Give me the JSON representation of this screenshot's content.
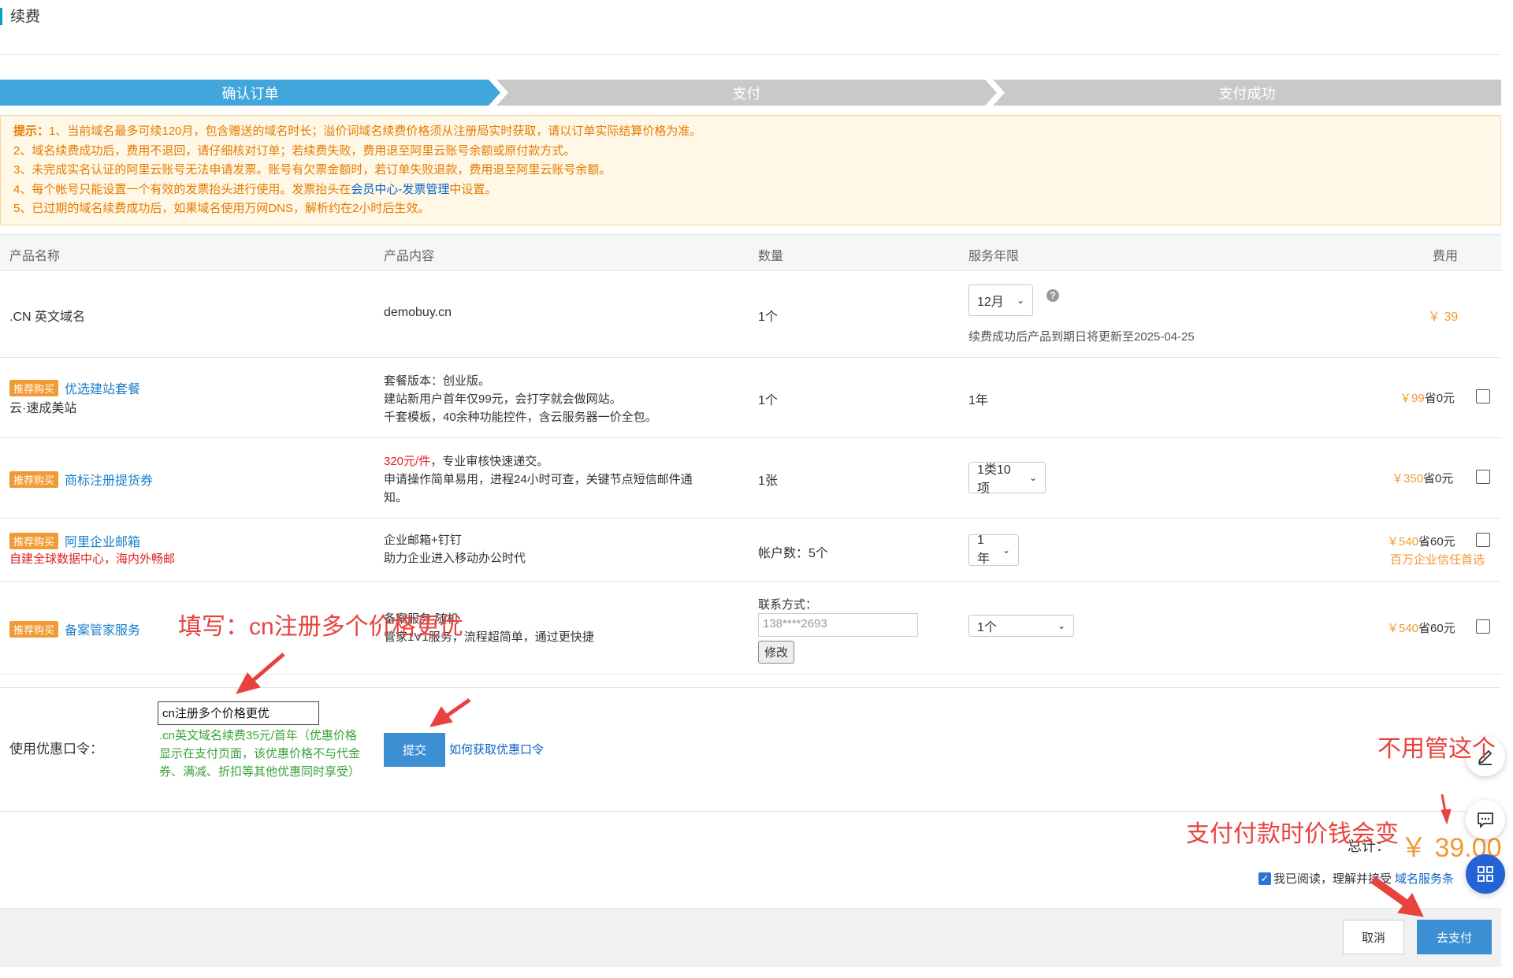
{
  "page": {
    "title": "续费"
  },
  "steps": [
    "确认订单",
    "支付",
    "支付成功"
  ],
  "notice": {
    "lines": [
      {
        "lead": "提示：",
        "text": "1、当前域名最多可续120月，包含赠送的域名时长；溢价词域名续费价格须从注册局实时获取，请以订单实际结算价格为准。"
      },
      {
        "text": "2、域名续费成功后，费用不退回，请仔细核对订单；若续费失败，费用退至阿里云账号余额或原付款方式。"
      },
      {
        "text": "3、未完成实名认证的阿里云账号无法申请发票。账号有欠票金额时，若订单失败退款，费用退至阿里云账号余额。"
      },
      {
        "text_pre": "4、每个帐号只能设置一个有效的发票抬头进行使用。发票抬头在",
        "link": "会员中心-发票管理",
        "text_post": "中设置。"
      },
      {
        "text": "5、已过期的域名续费成功后，如果域名使用万网DNS，解析约在2小时后生效。"
      }
    ]
  },
  "table": {
    "headers": [
      "产品名称",
      "产品内容",
      "数量",
      "服务年限",
      "费用"
    ],
    "rows": [
      {
        "name": ".CN 英文域名",
        "content": "demobuy.cn",
        "qty": "1个",
        "period": "12月",
        "period_note": "续费成功后产品到期日将更新至2025-04-25",
        "fee": "￥ 39"
      },
      {
        "badge": "推荐购买",
        "name": "优选建站套餐",
        "sub": "云·速成美站",
        "content": [
          "套餐版本：创业版。",
          "建站新用户首年仅99元，会打字就会做网站。",
          "千套模板，40余种功能控件，含云服务器一价全包。"
        ],
        "qty": "1个",
        "period": "1年",
        "fee_price": "￥99",
        "fee_save": "省0元"
      },
      {
        "badge": "推荐购买",
        "name": "商标注册提货券",
        "content_red": "320元/件",
        "content_rest": "，专业审核快速递交。",
        "content2": "申请操作简单易用，进程24小时可查，关键节点短信邮件通",
        "content3": "知。",
        "qty": "1张",
        "period": "1类10项",
        "fee_price": "￥350",
        "fee_save": "省0元"
      },
      {
        "badge": "推荐购买",
        "name": "阿里企业邮箱",
        "sub": "自建全球数据中心，海内外畅邮",
        "content": [
          "企业邮箱+钉钉",
          "助力企业进入移动办公时代"
        ],
        "qty": "帐户数：5个",
        "period": "1年",
        "fee_price": "￥540",
        "fee_save": "省60元",
        "fee_note": "百万企业信任首选"
      },
      {
        "badge": "推荐购买",
        "name": "备案管家服务",
        "content": [
          "备案服务·随机",
          "管家1V1服务，流程超简单，通过更快捷"
        ],
        "contact_label": "联系方式：",
        "contact_value": "138****2693",
        "modify_label": "修改",
        "period": "1个",
        "fee_price": "￥540",
        "fee_save": "省60元"
      }
    ]
  },
  "coupon": {
    "label": "使用优惠口令：",
    "value": "cn注册多个价格更优",
    "desc": ".cn英文域名续费35元/首年（优惠价格显示在支付页面，该优惠价格不与代金券、满减、折扣等其他优惠同时享受）",
    "submit": "提交",
    "how": "如何获取优惠口令"
  },
  "total": {
    "label": "总计：",
    "value": "￥ 39.00"
  },
  "agree": {
    "text": "我已阅读，理解并接受",
    "link": "域名服务条"
  },
  "actions": {
    "cancel": "取消",
    "pay": "去支付"
  },
  "annotations": {
    "fill": "填写：cn注册多个价格更优",
    "ignore": "不用管这个",
    "change": "支付付款时价钱会变"
  },
  "colors": {
    "primary": "#3d8fd4",
    "step_active": "#40a6dc",
    "warning_text": "#e67a00",
    "price": "#f29a36",
    "annotation": "#e8423f"
  }
}
